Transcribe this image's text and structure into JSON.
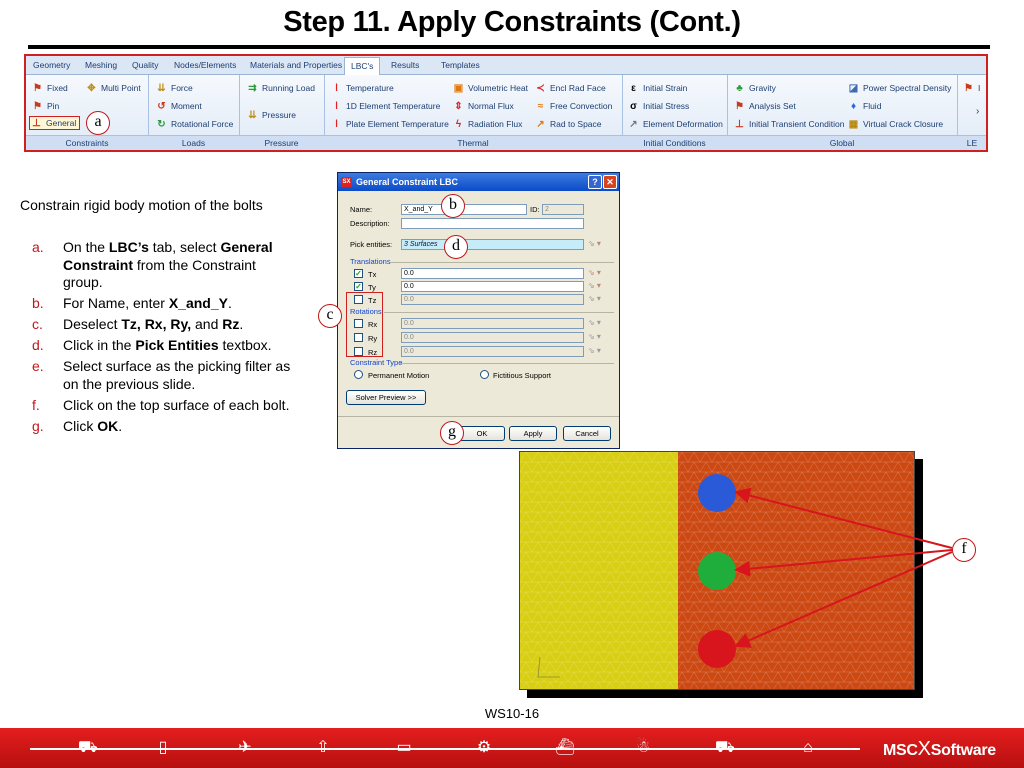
{
  "slide": {
    "title": "Step 11. Apply Constraints (Cont.)",
    "page_label": "WS10-16"
  },
  "ribbon": {
    "tabs": [
      "Geometry",
      "Meshing",
      "Quality",
      "Nodes/Elements",
      "Materials and Properties",
      "LBC's",
      "Results",
      "Templates"
    ],
    "active_tab": "LBC's",
    "groups": [
      "Constraints",
      "Loads",
      "Pressure",
      "Thermal",
      "Initial Conditions",
      "Global",
      "LE"
    ],
    "constraints": [
      "Fixed",
      "Multi Point",
      "Pin",
      "General"
    ],
    "loads": [
      "Force",
      "Moment",
      "Rotational Force"
    ],
    "pressure": [
      "Running Load",
      "Pressure"
    ],
    "thermal": [
      "Temperature",
      "1D Element Temperature",
      "Plate Element Temperature",
      "Volumetric Heat",
      "Normal Flux",
      "Radiation Flux",
      "Encl Rad Face",
      "Free Convection",
      "Rad to Space"
    ],
    "initial_conditions": [
      "Initial Strain",
      "Initial Stress",
      "Element Deformation"
    ],
    "global": [
      "Gravity",
      "Analysis Set",
      "Initial Transient Condition",
      "Power Spectral Density",
      "Fluid",
      "Virtual Crack Closure"
    ],
    "overflow_item": "I"
  },
  "instructions": {
    "intro": "Constrain rigid body motion of the bolts",
    "steps": [
      {
        "mark": "a.",
        "parts": [
          "On the ",
          "LBC’s",
          " tab, select ",
          "General Constraint",
          " from the Constraint group."
        ]
      },
      {
        "mark": "b.",
        "parts": [
          "For Name, enter ",
          "X_and_Y",
          "."
        ]
      },
      {
        "mark": "c.",
        "parts": [
          "Deselect ",
          "Tz, Rx, Ry,",
          " and ",
          "Rz",
          "."
        ]
      },
      {
        "mark": "d.",
        "parts": [
          "Click in the ",
          "Pick Entities",
          " textbox."
        ]
      },
      {
        "mark": "e.",
        "parts": [
          "Select surface as the picking filter as on the previous slide."
        ]
      },
      {
        "mark": "f.",
        "parts": [
          "Click on the top surface of each bolt."
        ]
      },
      {
        "mark": "g.",
        "parts": [
          "Click ",
          "OK",
          "."
        ]
      }
    ]
  },
  "dialog": {
    "title": "General Constraint LBC",
    "app_icon": "SX",
    "help": "?",
    "close": "✕",
    "name_label": "Name:",
    "name_value": "X_and_Y",
    "id_label": "ID:",
    "id_value": "2",
    "description_label": "Description:",
    "description_value": "",
    "pick_label": "Pick entities:",
    "pick_value": "3 Surfaces",
    "translations_title": "Translations",
    "rotations_title": "Rotations",
    "dofs": [
      {
        "label": "Tx",
        "checked": true,
        "value": "0.0"
      },
      {
        "label": "Ty",
        "checked": true,
        "value": "0.0"
      },
      {
        "label": "Tz",
        "checked": false,
        "value": "0.0"
      },
      {
        "label": "Rx",
        "checked": false,
        "value": "0.0"
      },
      {
        "label": "Ry",
        "checked": false,
        "value": "0.0"
      },
      {
        "label": "Rz",
        "checked": false,
        "value": "0.0"
      }
    ],
    "constraint_type_title": "Constraint Type",
    "permanent_motion": "Permanent Motion",
    "fictitious_support": "Fictitious Support",
    "solver_preview": "Solver Preview >>",
    "ok": "OK",
    "apply": "Apply",
    "cancel": "Cancel"
  },
  "callouts": {
    "a": "a",
    "b": "b",
    "c": "c",
    "d": "d",
    "f": "f",
    "g": "g"
  },
  "model": {
    "left_color": "#d8cf14",
    "right_color": "#cc4914",
    "bolt_colors": [
      "#2a5ad8",
      "#1fae3c",
      "#d8141c"
    ]
  },
  "footer": {
    "brand_left": "MSC",
    "brand_x": "X",
    "brand_right": "Software",
    "icons": [
      "car-icon",
      "phone-icon",
      "airplane-icon",
      "rocket-icon",
      "train-icon",
      "gear-icon",
      "ship-icon",
      "astronaut-icon",
      "truck-icon",
      "building-icon"
    ]
  },
  "colors": {
    "accent_red": "#c4161c",
    "ribbon_blue": "#1d3e72"
  }
}
